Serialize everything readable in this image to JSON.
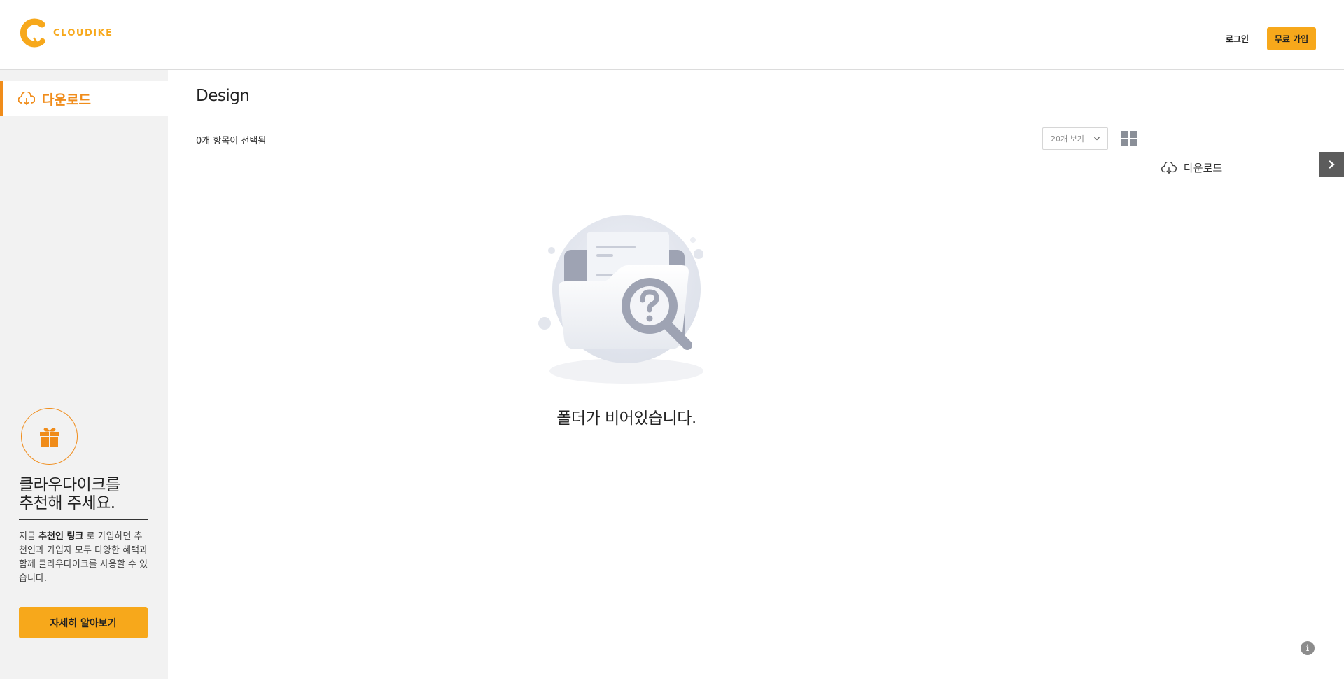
{
  "header": {
    "brand": "CLOUDIKE",
    "login_label": "로그인",
    "signup_label": "무료 가입"
  },
  "sidebar": {
    "items": [
      {
        "label": "다운로드",
        "icon": "cloud-download-icon",
        "active": true
      }
    ],
    "promo": {
      "title_line1": "클라우다이크를",
      "title_line2": "추천해 주세요.",
      "body_prefix": "지금 ",
      "body_bold": "추천인 링크",
      "body_suffix": " 로 가입하면 추천인과 가입자 모두 다양한 혜택과 함께 클라우다이크를 사용할 수 있습니다.",
      "button_label": "자세히 알아보기"
    }
  },
  "main": {
    "title": "Design",
    "selected_count": "0개 항목이 선택됨",
    "per_page": "20개 보기",
    "download_label": "다운로드",
    "empty_message": "폴더가 비어있습니다."
  },
  "colors": {
    "accent": "#f7a81b",
    "accent_dark": "#f08c1a",
    "sidebar_bg": "#f2f2f2"
  }
}
